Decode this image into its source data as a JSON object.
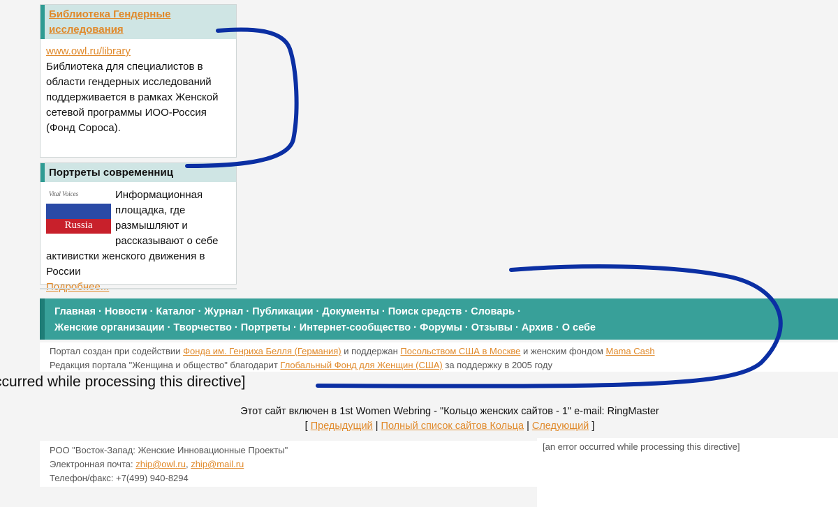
{
  "library_box": {
    "title": "Библиотека Гендерные исследования",
    "url": "www.owl.ru/library",
    "description": "Библиотека для специалистов в области гендерных исследований поддерживается в рамках Женской сетевой программы ИОО-Россия (Фонд Сороса)."
  },
  "portraits_box": {
    "title": "Портреты современниц",
    "logo_top_text": "Vital Voices",
    "logo_bottom_text": "Russia",
    "description": "Информационная площадка, где размышляют и рассказывают о себе активистки женского движения в России",
    "more_link": "Подробнее..."
  },
  "nav": {
    "row1": [
      "Главная",
      "Новости",
      "Каталог",
      "Журнал",
      "Публикации",
      "Документы",
      "Поиск средств",
      "Словарь"
    ],
    "row2": [
      "Женские организации",
      "Творчество",
      "Портреты",
      "Интернет-сообщество",
      "Форумы",
      "Отзывы",
      "Архив",
      "О себе"
    ],
    "separator": "·"
  },
  "credits": {
    "line1_prefix": "Портал создан при содействии ",
    "line1_link1": "Фонда им. Генриха Белля (Германия)",
    "line1_mid": " и поддержан ",
    "line1_link2": "Посольством США в Москве",
    "line1_mid2": " и женским фондом ",
    "line1_link3": "Mama Cash",
    "line2_prefix": "Редакция портала \"Женщина и общество\" благодарит ",
    "line2_link": "Глобальный Фонд для Женщин (США)",
    "line2_suffix": " за поддержку в 2005 году"
  },
  "error_large": "ccurred while processing this directive]",
  "webring": {
    "text": "Этот сайт включен в 1st Women Webring - \"Кольцо женских сайтов - 1\" e-mail: RingMaster",
    "bracket_open": "[",
    "prev": "Предыдущий",
    "sep": "|",
    "list": "Полный список сайтов Кольца",
    "next": "Следующий",
    "bracket_close": "]"
  },
  "contacts": {
    "org": "РОО \"Восток-Запад: Женские Инновационные Проекты\"",
    "email_label": "Электронная почта: ",
    "email1": "zhip@owl.ru",
    "email_sep": ", ",
    "email2": "zhip@mail.ru",
    "phone": "Телефон/факс: +7(499) 940-8294"
  },
  "error_small": "[an error occurred while processing this directive]",
  "colors": {
    "accent_teal": "#38a099",
    "link_orange": "#e0892a",
    "marker_blue": "#0b2fa3"
  }
}
